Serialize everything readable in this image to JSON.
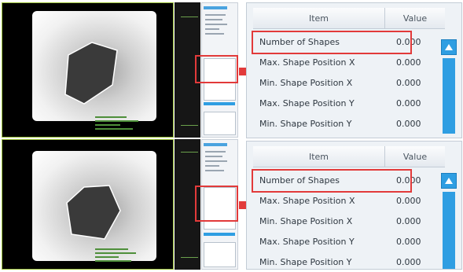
{
  "colors": {
    "accent": "#2f9ee2",
    "highlight": "#e23a3a",
    "frame": "#9cc23a"
  },
  "tables": [
    {
      "header": {
        "item": "Item",
        "value": "Value"
      },
      "rows": [
        {
          "item": "Number of Shapes",
          "value": "0.000"
        },
        {
          "item": "Max. Shape Position X",
          "value": "0.000"
        },
        {
          "item": "Min. Shape Position X",
          "value": "0.000"
        },
        {
          "item": "Max. Shape Position Y",
          "value": "0.000"
        },
        {
          "item": "Min. Shape Position Y",
          "value": "0.000"
        }
      ]
    },
    {
      "header": {
        "item": "Item",
        "value": "Value"
      },
      "rows": [
        {
          "item": "Number of Shapes",
          "value": "0.000"
        },
        {
          "item": "Max. Shape Position X",
          "value": "0.000"
        },
        {
          "item": "Min. Shape Position X",
          "value": "0.000"
        },
        {
          "item": "Max. Shape Position Y",
          "value": "0.000"
        },
        {
          "item": "Min. Shape Position Y",
          "value": "0.000"
        }
      ]
    }
  ],
  "icons": {
    "scroll_up": "scroll-up-icon",
    "arrow": "red-arrow-icon"
  }
}
